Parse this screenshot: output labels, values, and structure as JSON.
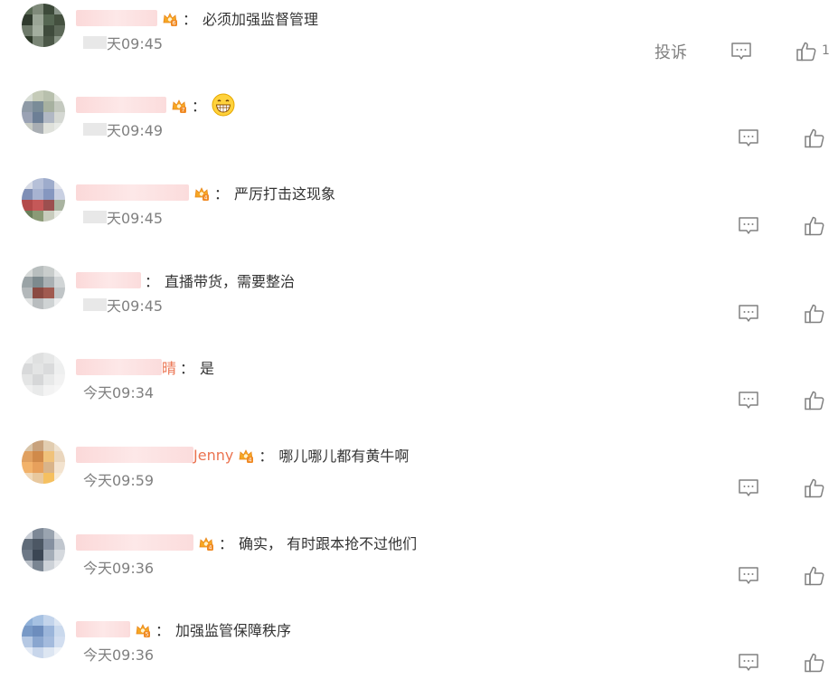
{
  "colors": {
    "accent_name": "#eb7350",
    "text": "#333333",
    "muted": "#808080",
    "icon": "#808080"
  },
  "comments": [
    {
      "name_visible": "",
      "badge": "6",
      "text": "必须加强监督管理",
      "time": "天09:45",
      "has_report": true,
      "report_label": "投诉",
      "likes": "1",
      "avatar": [
        "#5a6a55",
        "#7f8a7a",
        "#3d4a3a",
        "#8a958a",
        "#2f3a2d",
        "#9aa596",
        "#556652",
        "#44503f",
        "#6e7a6a",
        "#a3ae9f",
        "#3f4b3c",
        "#5c6858",
        "#2e3a2a",
        "#7a8676",
        "#4b5747",
        "#899586"
      ]
    },
    {
      "name_visible": "",
      "badge": "7",
      "text": "",
      "emoji": "grin",
      "time": "天09:49",
      "has_report": false,
      "likes": "",
      "avatar": [
        "#d9ded6",
        "#c5cbb8",
        "#b8c0ad",
        "#e3e6de",
        "#8e9aa6",
        "#7a8c98",
        "#a7b1a0",
        "#c4c9bf",
        "#9aa2b4",
        "#6d7f96",
        "#b1b8c4",
        "#d5d8d3",
        "#c8cbc4",
        "#a9aeb3",
        "#dfe1db",
        "#e8eae6"
      ]
    },
    {
      "name_visible": "",
      "badge": "4",
      "text": "严厉打击这现象",
      "time": "天09:45",
      "has_report": false,
      "likes": "",
      "avatar": [
        "#d7dbe6",
        "#b6c0d8",
        "#9eaccc",
        "#e1e4ec",
        "#7f8fb6",
        "#a7b3d1",
        "#8597c0",
        "#c9d0e2",
        "#b34a4a",
        "#c55858",
        "#9c4f4f",
        "#a9b3a0",
        "#6a7f5a",
        "#8a9a76",
        "#c8ccbd",
        "#e8eae4"
      ]
    },
    {
      "name_visible": "",
      "badge": "",
      "text": "直播带货，需要整治",
      "time": "天09:45",
      "has_report": false,
      "likes": "",
      "avatar": [
        "#d6d9d8",
        "#b8bebe",
        "#c9cdcc",
        "#e6e8e8",
        "#9aa3a6",
        "#7d8a8e",
        "#a9b0b3",
        "#d1d5d6",
        "#b3b8ba",
        "#8a4a42",
        "#a05a50",
        "#c0c5c7",
        "#e0e2e2",
        "#b9bdbf",
        "#cfd3d4",
        "#ecedee"
      ]
    },
    {
      "name_visible": "晴",
      "badge": "",
      "text": "是",
      "time": "今天09:34",
      "has_report": false,
      "likes": "",
      "avatar": [
        "#ebecec",
        "#dfe0e0",
        "#e6e7e7",
        "#f0f1f1",
        "#d8d9da",
        "#e3e4e4",
        "#dadbdc",
        "#eeefef",
        "#e4e5e5",
        "#d6d7d8",
        "#e8e9e9",
        "#f2f2f2",
        "#f0f0f0",
        "#e9eaea",
        "#f3f3f3",
        "#f6f6f6"
      ]
    },
    {
      "name_visible": "Jenny",
      "badge": "4",
      "text": "哪儿哪儿都有黄牛啊",
      "time": "今天09:59",
      "has_report": false,
      "likes": "",
      "avatar": [
        "#d9c4a8",
        "#c8a27c",
        "#e2cdb0",
        "#efe2d0",
        "#e0a060",
        "#d08a4a",
        "#f0c27a",
        "#ead6bd",
        "#f2b26a",
        "#e7a05c",
        "#d9b48a",
        "#f3e3cf",
        "#f0d8b8",
        "#e8c89e",
        "#f5c060",
        "#f7ebd9"
      ]
    },
    {
      "name_visible": "",
      "badge": "4",
      "text": "确实， 有时跟本抢不过他们",
      "time": "今天09:36",
      "has_report": false,
      "likes": "",
      "avatar": [
        "#c9ced6",
        "#7d8896",
        "#9aa4b0",
        "#dfe2e6",
        "#5f6b78",
        "#4c5764",
        "#8590a0",
        "#c0c6ce",
        "#6d7886",
        "#3b4654",
        "#a4adb8",
        "#d5d9de",
        "#b8bec6",
        "#7a8592",
        "#cdd2d8",
        "#e6e8eb"
      ]
    },
    {
      "name_visible": "",
      "badge": "5",
      "text": "加强监管保障秩序",
      "time": "今天09:36",
      "has_report": false,
      "likes": "",
      "avatar": [
        "#8fb0d8",
        "#a6c1e2",
        "#c3d4eb",
        "#dbe5f2",
        "#7899c6",
        "#6d8dbd",
        "#9bb5da",
        "#cad9ed",
        "#b5c8e3",
        "#8aa6cf",
        "#a4bbdd",
        "#d2def0",
        "#e3eaf5",
        "#c8d6eb",
        "#dde6f2",
        "#eef2f8"
      ]
    }
  ]
}
